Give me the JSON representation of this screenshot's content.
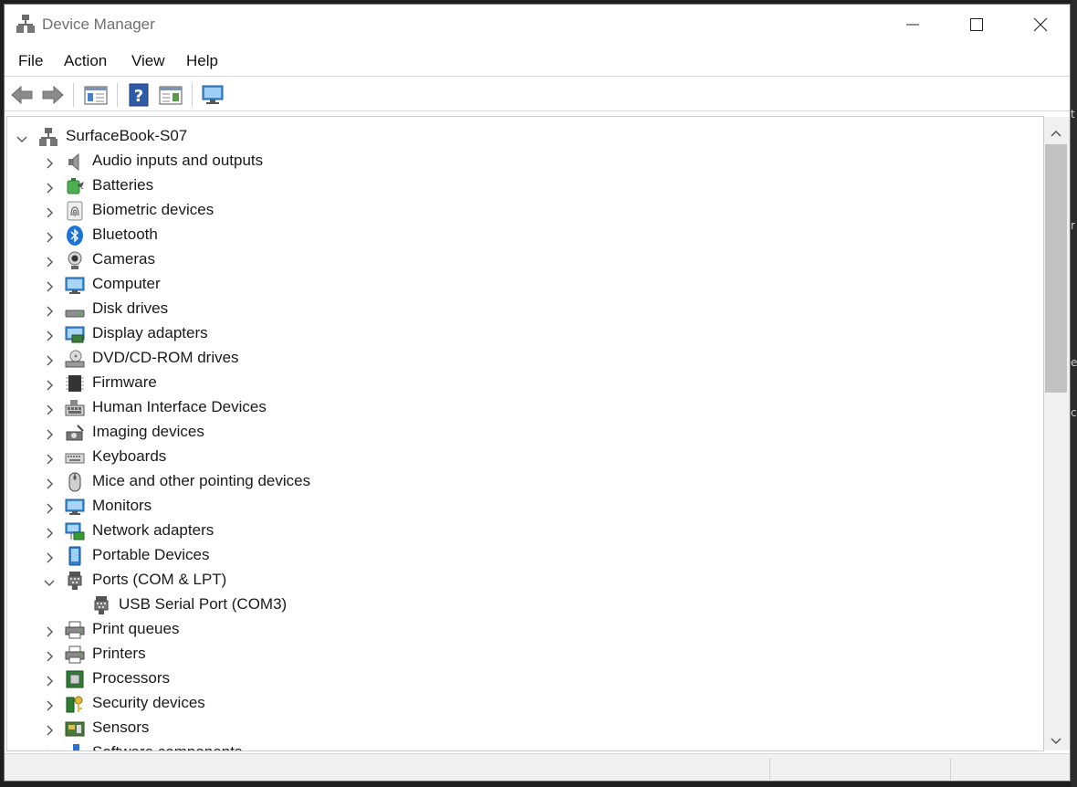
{
  "window": {
    "title": "Device Manager"
  },
  "menu": [
    "File",
    "Action",
    "View",
    "Help"
  ],
  "toolbar": [
    {
      "icon": "back-arrow-icon"
    },
    {
      "icon": "forward-arrow-icon"
    },
    {
      "icon": "show-hide-console-tree-icon"
    },
    {
      "icon": "help-icon"
    },
    {
      "icon": "properties-pane-icon"
    },
    {
      "icon": "scan-hardware-monitor-icon"
    }
  ],
  "tree": {
    "root": "SurfaceBook-S07",
    "items": [
      {
        "label": "Audio inputs and outputs",
        "icon": "speaker-icon",
        "expanded": false
      },
      {
        "label": "Batteries",
        "icon": "battery-icon",
        "expanded": false
      },
      {
        "label": "Biometric devices",
        "icon": "fingerprint-icon",
        "expanded": false
      },
      {
        "label": "Bluetooth",
        "icon": "bluetooth-icon",
        "expanded": false
      },
      {
        "label": "Cameras",
        "icon": "webcam-icon",
        "expanded": false
      },
      {
        "label": "Computer",
        "icon": "computer-icon",
        "expanded": false
      },
      {
        "label": "Disk drives",
        "icon": "disk-drive-icon",
        "expanded": false
      },
      {
        "label": "Display adapters",
        "icon": "display-adapter-icon",
        "expanded": false
      },
      {
        "label": "DVD/CD-ROM drives",
        "icon": "dvd-drive-icon",
        "expanded": false
      },
      {
        "label": "Firmware",
        "icon": "firmware-chip-icon",
        "expanded": false
      },
      {
        "label": "Human Interface Devices",
        "icon": "hid-keyboard-icon",
        "expanded": false
      },
      {
        "label": "Imaging devices",
        "icon": "imaging-camera-icon",
        "expanded": false
      },
      {
        "label": "Keyboards",
        "icon": "keyboard-icon",
        "expanded": false
      },
      {
        "label": "Mice and other pointing devices",
        "icon": "mouse-icon",
        "expanded": false
      },
      {
        "label": "Monitors",
        "icon": "monitor-icon",
        "expanded": false
      },
      {
        "label": "Network adapters",
        "icon": "network-adapter-icon",
        "expanded": false
      },
      {
        "label": "Portable Devices",
        "icon": "portable-device-icon",
        "expanded": false
      },
      {
        "label": "Ports (COM & LPT)",
        "icon": "port-connector-icon",
        "expanded": true,
        "children": [
          {
            "label": "USB Serial Port (COM3)",
            "icon": "port-connector-icon"
          }
        ]
      },
      {
        "label": "Print queues",
        "icon": "printer-icon",
        "expanded": false
      },
      {
        "label": "Printers",
        "icon": "printer-icon",
        "expanded": false
      },
      {
        "label": "Processors",
        "icon": "processor-chip-icon",
        "expanded": false
      },
      {
        "label": "Security devices",
        "icon": "security-key-icon",
        "expanded": false
      },
      {
        "label": "Sensors",
        "icon": "sensor-board-icon",
        "expanded": false
      },
      {
        "label": "Software components",
        "icon": "software-component-icon",
        "expanded": false
      }
    ]
  }
}
